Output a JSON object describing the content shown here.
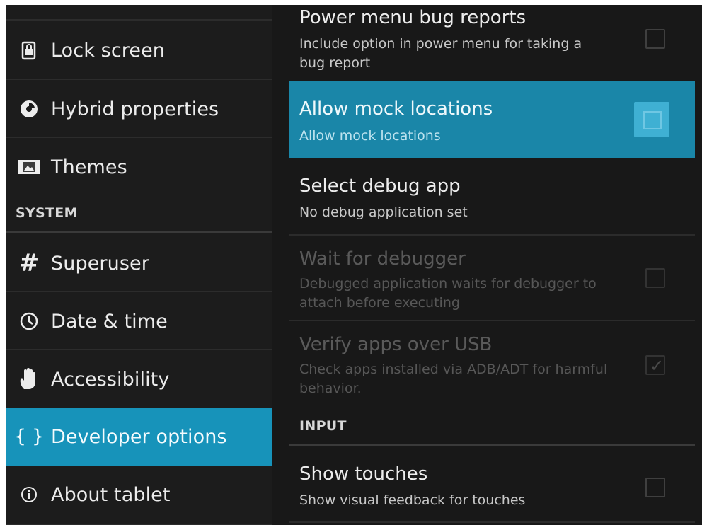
{
  "sidebar": {
    "items": [
      {
        "label": "Lock screen",
        "icon": "lock-screen-icon"
      },
      {
        "label": "Hybrid properties",
        "icon": "hybrid-icon"
      },
      {
        "label": "Themes",
        "icon": "themes-icon"
      },
      {
        "label": "Superuser",
        "icon": "hash-icon",
        "glyph": "#"
      },
      {
        "label": "Date & time",
        "icon": "clock-icon"
      },
      {
        "label": "Accessibility",
        "icon": "hand-icon"
      },
      {
        "label": "Developer options",
        "icon": "braces-icon",
        "glyph": "{ }",
        "active": true
      },
      {
        "label": "About tablet",
        "icon": "info-icon"
      }
    ],
    "section_system": "SYSTEM",
    "active_color": "#1793ba"
  },
  "content": {
    "prefs": [
      {
        "title": "Power menu bug reports",
        "summary": "Include option in power menu for taking a bug report",
        "checked": false,
        "enabled": true
      },
      {
        "title": "Allow mock locations",
        "summary": "Allow mock locations",
        "checked": false,
        "enabled": true,
        "highlighted": true
      },
      {
        "title": "Select debug app",
        "summary": "No debug application set"
      },
      {
        "title": "Wait for debugger",
        "summary": "Debugged application waits for debugger to attach before executing",
        "checked": false,
        "enabled": false
      },
      {
        "title": "Verify apps over USB",
        "summary": "Check apps installed via ADB/ADT for harmful behavior.",
        "checked": true,
        "enabled": false
      },
      {
        "title": "Show touches",
        "summary": "Show visual feedback for touches",
        "checked": false,
        "enabled": true
      }
    ],
    "section_input": "INPUT",
    "highlight_color": "#1a86a8",
    "checkmark_glyph": "✓"
  }
}
